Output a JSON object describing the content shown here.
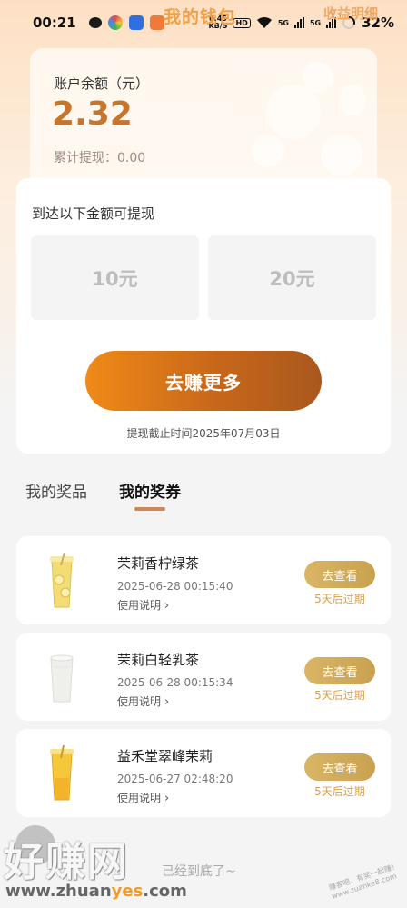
{
  "status_bar": {
    "time": "00:21",
    "speed_value": "0.45",
    "speed_unit": "KB/S",
    "hd": "HD",
    "network_1": "5G",
    "network_2": "5G",
    "battery": "32%"
  },
  "header": {
    "title": "我的钱包",
    "income_detail": "收益明细"
  },
  "balance": {
    "label": "账户余额（元）",
    "amount": "2.32",
    "withdrawn_label": "累计提现：",
    "withdrawn_value": "0.00"
  },
  "withdraw": {
    "title": "到达以下金额可提现",
    "options": [
      "10元",
      "20元"
    ],
    "earn_button": "去赚更多",
    "deadline": "提现截止时间2025年07月03日"
  },
  "tabs": {
    "prizes": "我的奖品",
    "coupons": "我的奖券",
    "active": "coupons"
  },
  "coupons": [
    {
      "name": "茉莉香柠绿茶",
      "time": "2025-06-28 00:15:40",
      "usage": "使用说明",
      "button": "去查看",
      "expire": "5天后过期",
      "drink_color": "#f3dc74"
    },
    {
      "name": "茉莉白轻乳茶",
      "time": "2025-06-28 00:15:34",
      "usage": "使用说明",
      "button": "去查看",
      "expire": "5天后过期",
      "drink_color": "#eeeeea"
    },
    {
      "name": "益禾堂翠峰茉莉",
      "time": "2025-06-27 02:48:20",
      "usage": "使用说明",
      "button": "去查看",
      "expire": "5天后过期",
      "drink_color": "#f5c83a"
    }
  ],
  "footer": {
    "end_text": "已经到底了~"
  },
  "watermark": {
    "logo": "好赚网",
    "domain_pre": "www.zhuan",
    "domain_accent": "yes",
    "domain_post": ".com",
    "tag": "赚客吧，有奖一起赚！ www.zuanke8.com"
  },
  "colors": {
    "accent": "#c5752e",
    "button_gradient_start": "#f08a18",
    "button_gradient_end": "#a9581e",
    "view_button": "#d0aa58"
  }
}
